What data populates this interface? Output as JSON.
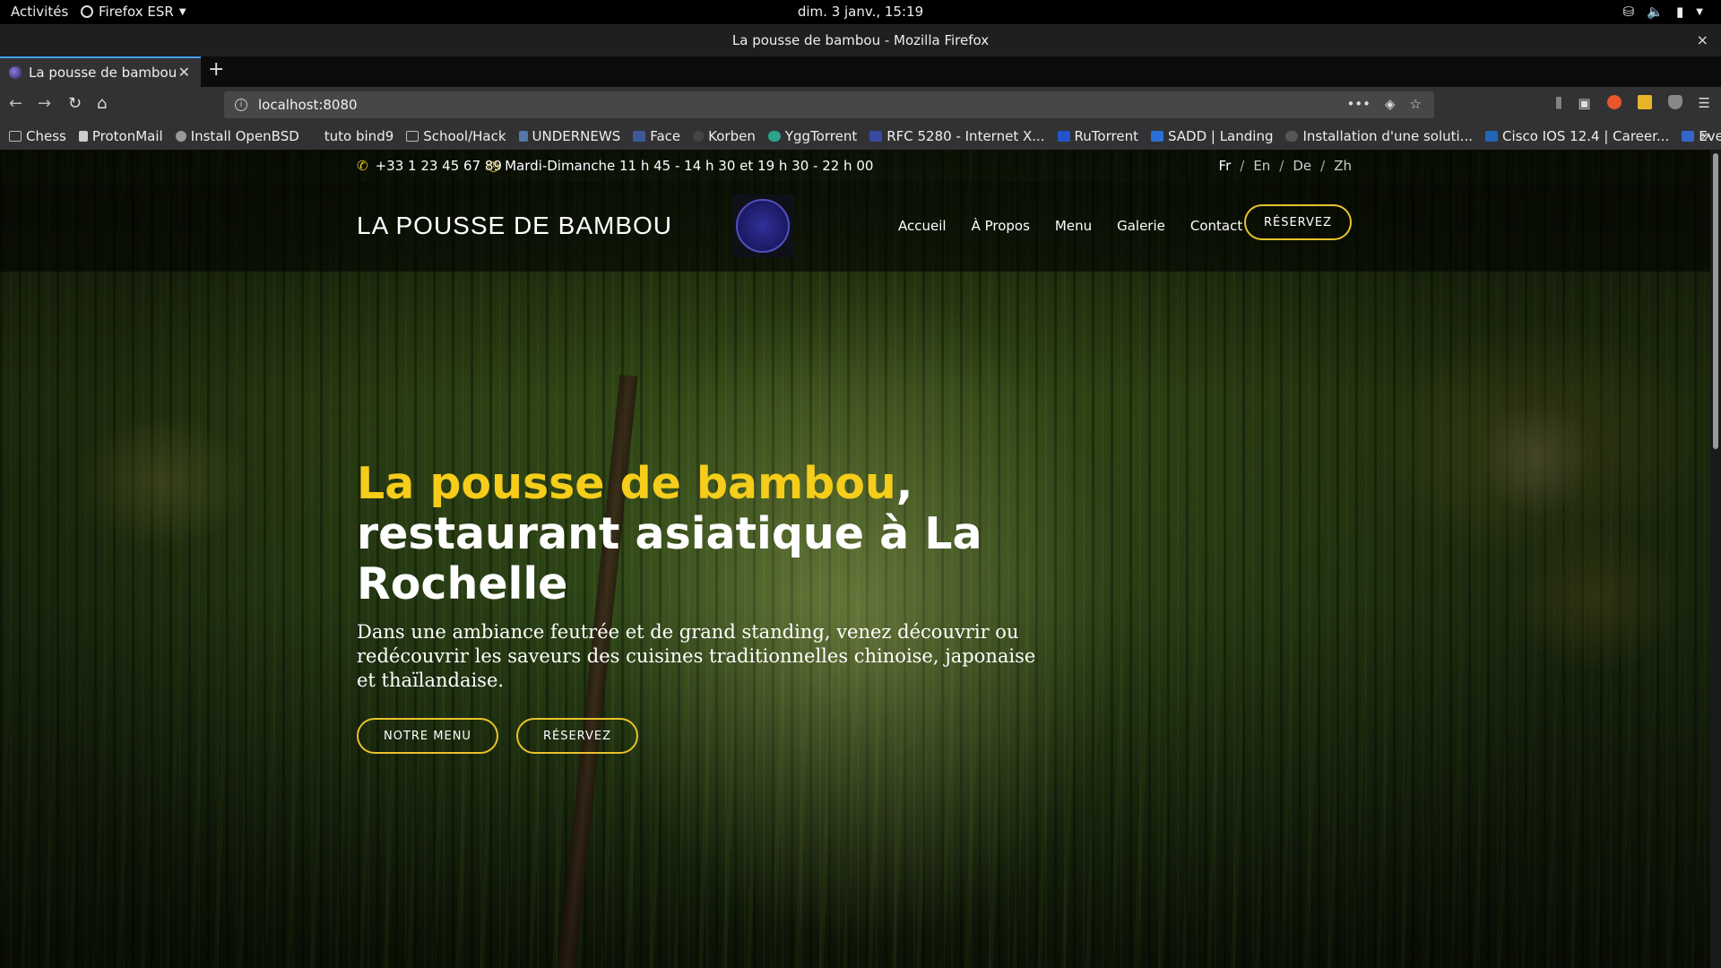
{
  "system_bar": {
    "activities": "Activités",
    "app_name": "Firefox ESR",
    "clock": "dim.  3 janv., 15:19"
  },
  "window": {
    "title": "La pousse de bambou - Mozilla Firefox",
    "close": "×"
  },
  "tab": {
    "title": "La pousse de bambou",
    "close": "✕",
    "new_tab": "+"
  },
  "navbar": {
    "url": "localhost:8080",
    "more": "•••"
  },
  "bookmarks": [
    {
      "label": "Chess",
      "color": "#bbbbbb"
    },
    {
      "label": "ProtonMail",
      "color": "#cccccc"
    },
    {
      "label": "Install OpenBSD",
      "color": "#999999"
    },
    {
      "label": "tuto bind9",
      "color": "transparent"
    },
    {
      "label": "School/Hack",
      "color": "#bbbbbb"
    },
    {
      "label": "UNDERNEWS",
      "color": "#5577aa"
    },
    {
      "label": "Face",
      "color": "#3b5998"
    },
    {
      "label": "Korben",
      "color": "#444444"
    },
    {
      "label": "YggTorrent",
      "color": "#2aa38a"
    },
    {
      "label": "RFC 5280 - Internet X...",
      "color": "#3a4aa0"
    },
    {
      "label": "RuTorrent",
      "color": "#2255cc"
    },
    {
      "label": "SADD | Landing",
      "color": "#2a6fd6"
    },
    {
      "label": "Installation d'une soluti...",
      "color": "#555555"
    },
    {
      "label": "Cisco IOS 12.4 | Career...",
      "color": "#2266bb"
    },
    {
      "label": "Eve-NG",
      "color": "#3366cc"
    }
  ],
  "site": {
    "phone": "+33 1 23 45 67 89",
    "hours": "Mardi-Dimanche 11 h 45 - 14 h 30 et 19 h 30 - 22 h 00",
    "languages": [
      "Fr",
      "En",
      "De",
      "Zh"
    ],
    "brand": "LA POUSSE DE BAMBOU",
    "menu": [
      "Accueil",
      "À Propos",
      "Menu",
      "Galerie",
      "Contact"
    ],
    "cta": "RÉSERVEZ",
    "hero": {
      "title_highlight": "La pousse de bambou",
      "title_rest": ", restaurant asiatique à La Rochelle",
      "subtitle": "Dans une ambiance feutrée et de grand standing, venez découvrir ou redécouvrir les saveurs des cuisines traditionnelles chinoise, japonaise et thaïlandaise.",
      "btn_menu": "NOTRE MENU",
      "btn_reserve": "RÉSERVEZ"
    },
    "accent_color": "#e8c32a"
  }
}
